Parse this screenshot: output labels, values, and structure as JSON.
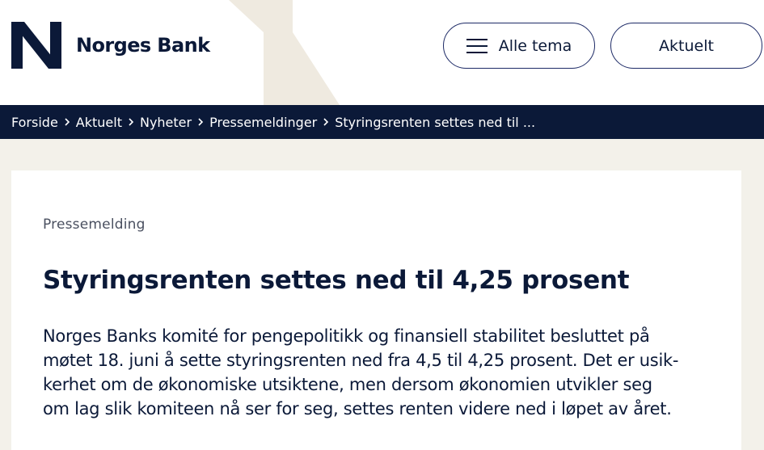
{
  "header": {
    "logo_text": "Norges Bank",
    "menu_button_label": "Alle tema",
    "news_button_label": "Aktuelt"
  },
  "breadcrumb": {
    "items": [
      "Forside",
      "Aktuelt",
      "Nyheter",
      "Pressemeldinger"
    ],
    "current": "Styringsrenten settes ned til ..."
  },
  "article": {
    "kicker": "Pressemelding",
    "title": "Styringsrenten settes ned til 4,25 prosent",
    "lead": "Norges Banks komité for pengepolitikk og finansiell stabilitet besluttet på\nmøtet 18. juni å sette styringsrenten ned fra 4,5 til 4,25 prosent. Det er usik-\nkerhet om de økonomiske utsiktene, men dersom økonomien utvikler seg\nom lag slik komiteen nå ser for seg, settes renten videre ned i løpet av året."
  },
  "colors": {
    "navy": "#0b1938",
    "button_border": "#1d2a66",
    "background": "#f3f1ea",
    "decor_shape": "#efeae0"
  },
  "icons": {
    "logo": "norges-bank-n-logo",
    "menu": "hamburger-icon",
    "separator": "chevron-right-icon"
  }
}
